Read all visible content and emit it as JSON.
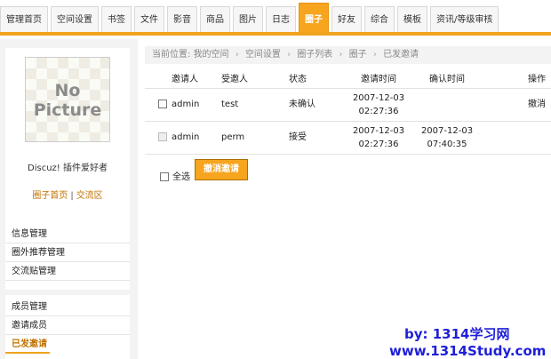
{
  "nav": {
    "tabs": [
      "管理首页",
      "空间设置",
      "书签",
      "文件",
      "影音",
      "商品",
      "图片",
      "日志",
      "圈子",
      "好友",
      "综合",
      "模板",
      "资讯/等级审核"
    ],
    "active": "圈子"
  },
  "profile": {
    "avatar_line1": "No",
    "avatar_line2": "Picture",
    "owner": "Discuz! 插件爱好者",
    "link_home": "圈子首页",
    "link_sep": "|",
    "link_exchange": "交流区"
  },
  "sidebar": {
    "group1": [
      "信息管理",
      "圈外推荐管理",
      "交流贴管理"
    ],
    "group2": [
      "成员管理",
      "邀请成员",
      "已发邀请"
    ],
    "current": "已发邀请"
  },
  "breadcrumb": {
    "prefix": "当前位置:",
    "items": [
      "我的空间",
      "空间设置",
      "圈子列表",
      "圈子",
      "已发邀请"
    ],
    "sep": "›"
  },
  "table": {
    "headers": [
      "邀请人",
      "受邀人",
      "状态",
      "邀请时间",
      "确认时间",
      "操作"
    ],
    "rows": [
      {
        "inviter": "admin",
        "invitee": "test",
        "status": "未确认",
        "invite_date": "2007-12-03",
        "invite_time": "02:27:36",
        "confirm_date": "",
        "confirm_time": "",
        "action": "撤消",
        "checkbox_enabled": true
      },
      {
        "inviter": "admin",
        "invitee": "perm",
        "status": "接受",
        "invite_date": "2007-12-03",
        "invite_time": "02:27:36",
        "confirm_date": "2007-12-03",
        "confirm_time": "07:40:35",
        "action": "",
        "checkbox_enabled": false
      }
    ]
  },
  "actions": {
    "select_all": "全选",
    "cancel_invite": "撤消邀请"
  },
  "watermark": {
    "line1": "by: 1314学习网",
    "line2": "www.1314Study.com"
  },
  "colors": {
    "accent": "#f7a51f",
    "link": "#c07200",
    "watermark": "#1f1fd8"
  }
}
